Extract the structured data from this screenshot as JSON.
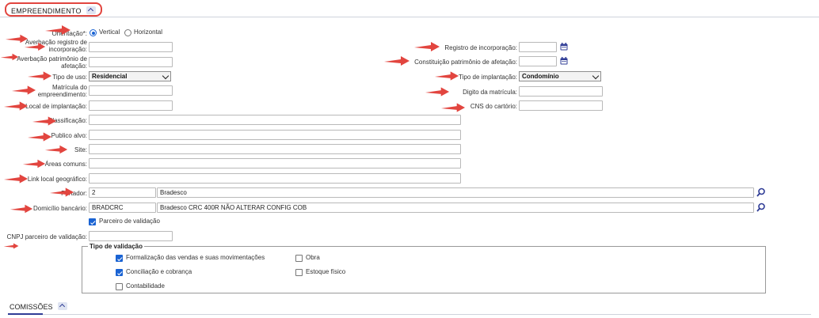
{
  "section": {
    "title": "EMPREENDIMENTO"
  },
  "orientation": {
    "label": "Orientação*:",
    "vertical": "Vertical",
    "horizontal": "Horizontal",
    "selected": "Vertical"
  },
  "left": {
    "averbacao_registro": {
      "label_line1": "Averbação registro de",
      "label_line2": "incorporação:",
      "value": ""
    },
    "averbacao_patrimonio": {
      "label_line1": "Averbação patrimônio de",
      "label_line2": "afetação:",
      "value": ""
    },
    "tipo_uso": {
      "label": "Tipo de uso:",
      "value": "Residencial"
    },
    "matricula": {
      "label_line1": "Matrícula do",
      "label_line2": "empreendimento:",
      "value": ""
    },
    "local_implantacao": {
      "label": "Local de implantação:",
      "value": ""
    },
    "classificacao": {
      "label": "Classificação:",
      "value": ""
    },
    "publico_alvo": {
      "label": "Publico alvo:",
      "value": ""
    },
    "site": {
      "label": "Site:",
      "value": ""
    },
    "areas_comuns": {
      "label": "Áreas comuns:",
      "value": ""
    },
    "link_local": {
      "label": "Link local geográfico:",
      "value": ""
    },
    "portador": {
      "label": "Portador:",
      "code": "2",
      "name": "Bradesco"
    },
    "domicilio": {
      "label": "Domicílio bancário:",
      "code": "BRADCRC",
      "name": "Bradesco CRC 400R NÃO ALTERAR CONFIG COB"
    },
    "parceiro_validacao": {
      "label": "Parceiro de validação",
      "checked": true
    },
    "cnpj_parceiro": {
      "label": "CNPJ parceiro de validação:",
      "value": ""
    }
  },
  "right": {
    "registro_incorporacao": {
      "label": "Registro de incorporação:",
      "value": ""
    },
    "constituicao_patrimonio": {
      "label": "Constituição patrimônio de afetação:",
      "value": ""
    },
    "tipo_implantacao": {
      "label": "Tipo de implantação:",
      "value": "Condomínio"
    },
    "digito_matricula": {
      "label": "Digito da matrícula:",
      "value": ""
    },
    "cns_cartorio": {
      "label": "CNS do cartório:",
      "value": ""
    }
  },
  "tipo_validacao": {
    "legend": "Tipo de validação",
    "options": [
      {
        "label": "Formalização das vendas e suas movimentações",
        "checked": true
      },
      {
        "label": "Obra",
        "checked": false
      },
      {
        "label": "Conciliação e cobrança",
        "checked": true
      },
      {
        "label": "Estoque físico",
        "checked": false
      },
      {
        "label": "Contabilidade",
        "checked": false
      }
    ]
  },
  "footer": {
    "title": "COMISSÕES"
  },
  "colors": {
    "accent": "#1a63d3",
    "highlight_red": "#e2453f",
    "nav_blue": "#2f3c96"
  }
}
